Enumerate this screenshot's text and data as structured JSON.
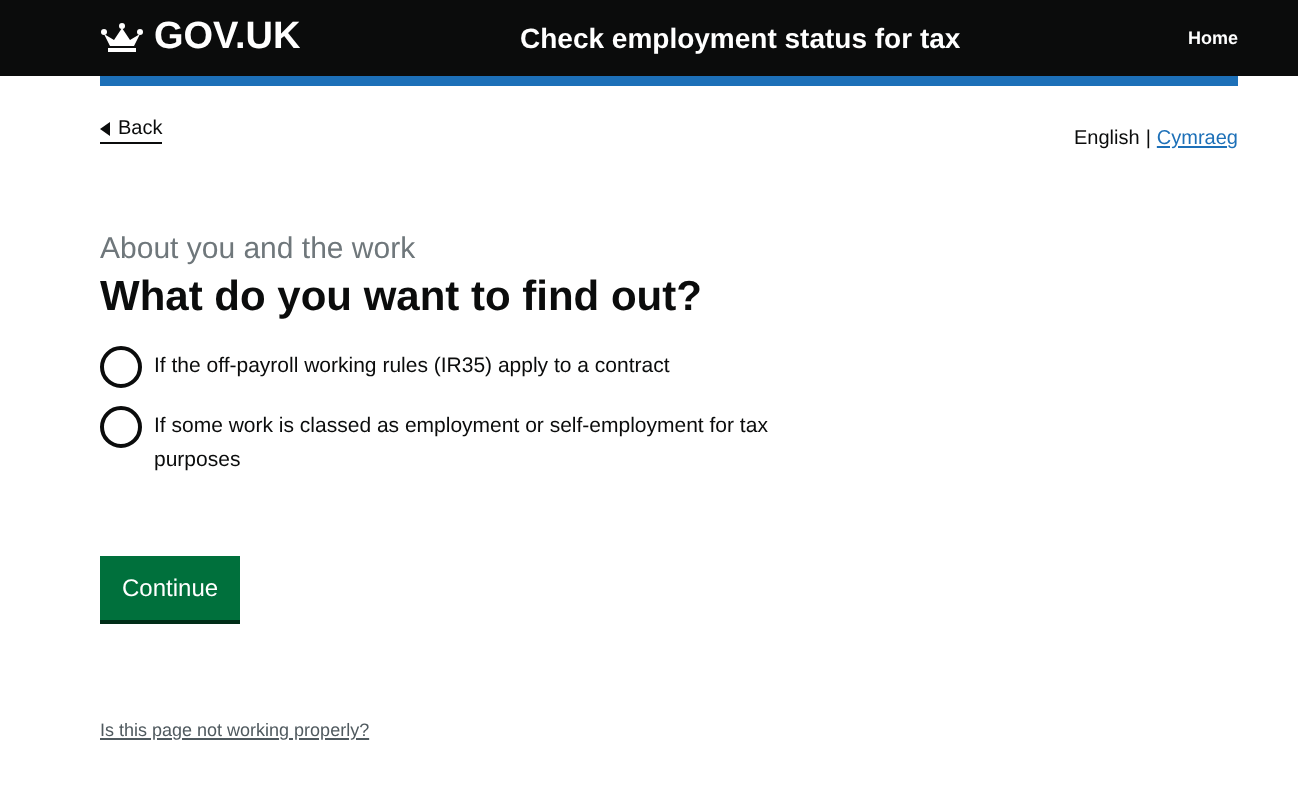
{
  "header": {
    "logo": "GOV.UK",
    "service_name": "Check employment status for tax",
    "nav_link": "Home"
  },
  "back_link": "Back",
  "languages": [
    {
      "label": "English",
      "selected": true
    },
    {
      "label": "Cymraeg",
      "selected": false
    }
  ],
  "language_separator": "|",
  "caption": "About you and the work",
  "question": "What do you want to find out?",
  "options": [
    {
      "label": "If the off-payroll working rules (IR35) apply to a contract",
      "selected": false
    },
    {
      "label": "If some work is classed as employment or self-employment for tax purposes",
      "selected": false
    }
  ],
  "continue_button": "Continue",
  "footer_link": "Is this page not working properly?"
}
